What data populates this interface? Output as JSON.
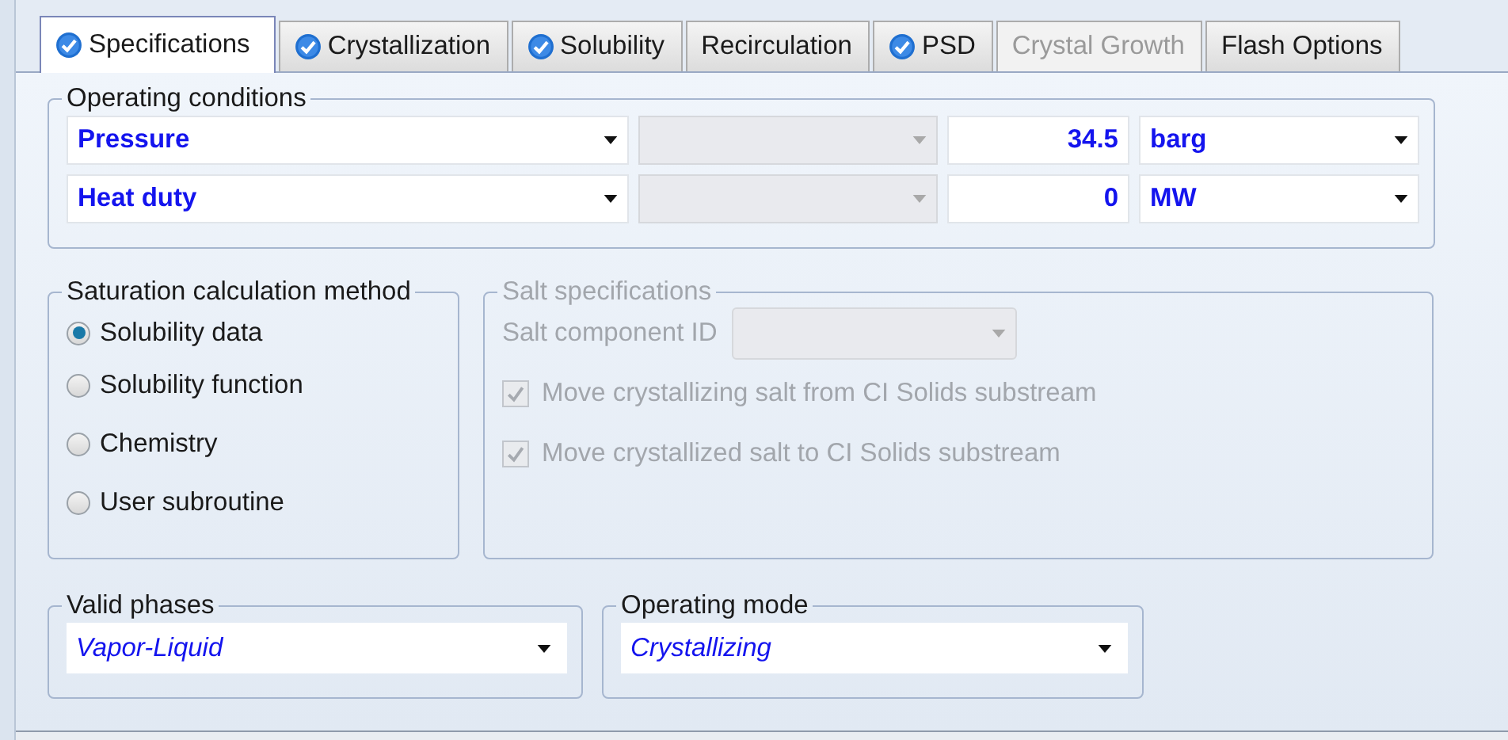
{
  "tabs": [
    {
      "label": "Specifications",
      "selected": true,
      "complete": true,
      "disabled": false
    },
    {
      "label": "Crystallization",
      "selected": false,
      "complete": true,
      "disabled": false
    },
    {
      "label": "Solubility",
      "selected": false,
      "complete": true,
      "disabled": false
    },
    {
      "label": "Recirculation",
      "selected": false,
      "complete": false,
      "disabled": false
    },
    {
      "label": "PSD",
      "selected": false,
      "complete": true,
      "disabled": false
    },
    {
      "label": "Crystal Growth",
      "selected": false,
      "complete": false,
      "disabled": true
    },
    {
      "label": "Flash Options",
      "selected": false,
      "complete": false,
      "disabled": false
    }
  ],
  "operating_conditions": {
    "title": "Operating conditions",
    "rows": [
      {
        "variable": "Pressure",
        "value": "34.5",
        "unit": "barg"
      },
      {
        "variable": "Heat duty",
        "value": "0",
        "unit": "MW"
      }
    ]
  },
  "saturation_method": {
    "title": "Saturation calculation method",
    "options": [
      {
        "label": "Solubility data",
        "selected": true
      },
      {
        "label": "Solubility function",
        "selected": false
      },
      {
        "label": "Chemistry",
        "selected": false
      },
      {
        "label": "User subroutine",
        "selected": false
      }
    ]
  },
  "salt_specifications": {
    "title": "Salt specifications",
    "disabled": true,
    "component_label": "Salt component ID",
    "checkboxes": [
      {
        "label": "Move crystallizing salt from CI Solids substream",
        "checked": true
      },
      {
        "label": "Move crystallized salt to CI Solids substream",
        "checked": true
      }
    ]
  },
  "valid_phases": {
    "title": "Valid phases",
    "value": "Vapor-Liquid"
  },
  "operating_mode": {
    "title": "Operating mode",
    "value": "Crystallizing"
  }
}
